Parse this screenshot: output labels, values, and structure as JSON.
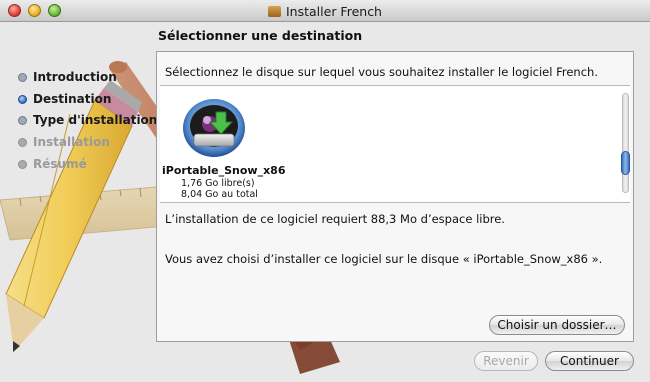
{
  "window": {
    "title": "Installer French"
  },
  "steps": [
    {
      "label": "Introduction",
      "state": "done"
    },
    {
      "label": "Destination",
      "state": "current"
    },
    {
      "label": "Type d'installation",
      "state": "future-bold"
    },
    {
      "label": "Installation",
      "state": "future"
    },
    {
      "label": "Résumé",
      "state": "future"
    }
  ],
  "main": {
    "heading": "Sélectionner une destination",
    "prompt": "Sélectionnez le disque sur lequel vous souhaitez installer le logiciel French.",
    "volume": {
      "name": "iPortable_Snow_x86",
      "free": "1,76 Go libre(s)",
      "total": "8,04 Go au total",
      "icon": "hard-disk-install-icon"
    },
    "requirement": "L’installation de ce logiciel requiert 88,3 Mo d’espace libre.",
    "chosen": "Vous avez choisi d’installer ce logiciel sur le disque « iPortable_Snow_x86 ».",
    "choose_folder_label": "Choisir un dossier…"
  },
  "footer": {
    "back_label": "Revenir",
    "continue_label": "Continuer"
  },
  "colors": {
    "accent": "#3c78c8",
    "panel": "#f7f7f7"
  }
}
